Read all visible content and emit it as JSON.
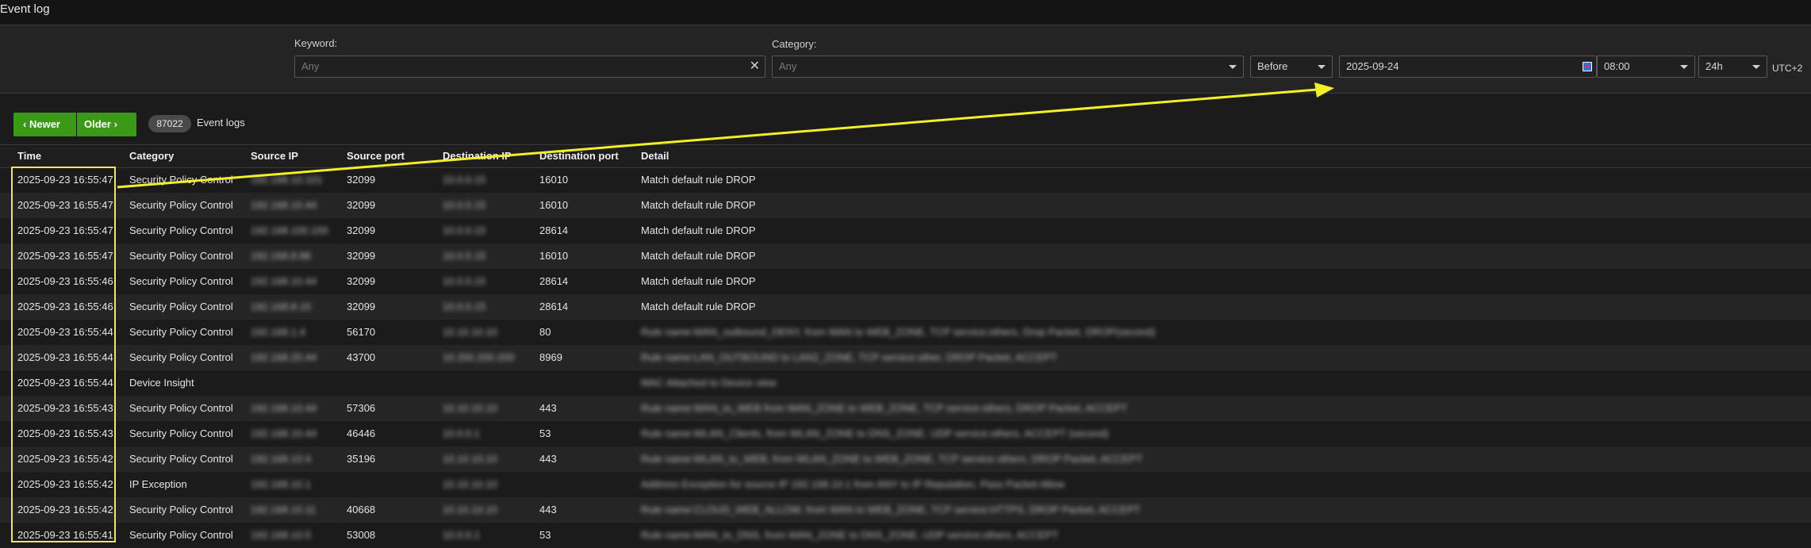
{
  "page_title": "Event log",
  "filters": {
    "keyword_label": "Keyword:",
    "keyword_placeholder": "Any",
    "category_label": "Category:",
    "category_placeholder": "Any",
    "time_relation": "Before",
    "date": "2025-09-24",
    "time": "08:00",
    "time_format": "24h",
    "timezone": "UTC+2"
  },
  "nav": {
    "newer_label": "Newer",
    "older_label": "Older"
  },
  "log_count": "87022",
  "log_count_label": "Event logs",
  "columns": [
    "Time",
    "Category",
    "Source IP",
    "Source port",
    "Destination IP",
    "Destination port",
    "Detail"
  ],
  "rows": [
    {
      "time": "2025-09-23 16:55:47",
      "category": "Security Policy Control",
      "src_ip": "192.168.10.101",
      "src_port": "32099",
      "dst_ip": "10.0.0.15",
      "dst_port": "16010",
      "detail": "Match default rule DROP"
    },
    {
      "time": "2025-09-23 16:55:47",
      "category": "Security Policy Control",
      "src_ip": "192.168.10.44",
      "src_port": "32099",
      "dst_ip": "10.0.0.15",
      "dst_port": "16010",
      "detail": "Match default rule DROP"
    },
    {
      "time": "2025-09-23 16:55:47",
      "category": "Security Policy Control",
      "src_ip": "192.168.100.100",
      "src_port": "32099",
      "dst_ip": "10.0.0.15",
      "dst_port": "28614",
      "detail": "Match default rule DROP"
    },
    {
      "time": "2025-09-23 16:55:47",
      "category": "Security Policy Control",
      "src_ip": "192.168.8.88",
      "src_port": "32099",
      "dst_ip": "10.0.0.15",
      "dst_port": "16010",
      "detail": "Match default rule DROP"
    },
    {
      "time": "2025-09-23 16:55:46",
      "category": "Security Policy Control",
      "src_ip": "192.168.10.44",
      "src_port": "32099",
      "dst_ip": "10.0.0.15",
      "dst_port": "28614",
      "detail": "Match default rule DROP"
    },
    {
      "time": "2025-09-23 16:55:46",
      "category": "Security Policy Control",
      "src_ip": "192.168.8.10",
      "src_port": "32099",
      "dst_ip": "10.0.0.15",
      "dst_port": "28614",
      "detail": "Match default rule DROP"
    },
    {
      "time": "2025-09-23 16:55:44",
      "category": "Security Policy Control",
      "src_ip": "192.168.1.4",
      "src_port": "56170",
      "dst_ip": "10.10.10.10",
      "dst_port": "80",
      "detail": "Rule name:WAN_outbound_DENY, from WAN to WEB_ZONE, TCP service:others, Drop Packet, DROP(second)"
    },
    {
      "time": "2025-09-23 16:55:44",
      "category": "Security Policy Control",
      "src_ip": "192.168.20.44",
      "src_port": "43700",
      "dst_ip": "10.200.200.200",
      "dst_port": "8969",
      "detail": "Rule name:LAN_OUTBOUND to LAN2_ZONE, TCP service:other, DROP Packet, ACCEPT"
    },
    {
      "time": "2025-09-23 16:55:44",
      "category": "Device Insight",
      "src_ip": "",
      "src_port": "",
      "dst_ip": "",
      "dst_port": "",
      "detail": "MAC Attached to Device view"
    },
    {
      "time": "2025-09-23 16:55:43",
      "category": "Security Policy Control",
      "src_ip": "192.168.10.44",
      "src_port": "57306",
      "dst_ip": "10.10.10.10",
      "dst_port": "443",
      "detail": "Rule name:WAN_to_WEB from WAN_ZONE to WEB_ZONE, TCP service:others, DROP Packet, ACCEPT"
    },
    {
      "time": "2025-09-23 16:55:43",
      "category": "Security Policy Control",
      "src_ip": "192.168.10.44",
      "src_port": "46446",
      "dst_ip": "10.0.0.1",
      "dst_port": "53",
      "detail": "Rule name:WLAN_Clients, from WLAN_ZONE to DNS_ZONE, UDP service:others, ACCEPT (second)"
    },
    {
      "time": "2025-09-23 16:55:42",
      "category": "Security Policy Control",
      "src_ip": "192.168.10.4",
      "src_port": "35196",
      "dst_ip": "10.10.10.10",
      "dst_port": "443",
      "detail": "Rule name:WLAN_to_WEB, from WLAN_ZONE to WEB_ZONE, TCP service others, DROP Packet, ACCEPT"
    },
    {
      "time": "2025-09-23 16:55:42",
      "category": "IP Exception",
      "src_ip": "192.168.10.1",
      "src_port": "",
      "dst_ip": "10.10.10.10",
      "dst_port": "",
      "detail": "Address Exception for source IP 192.168.10.1 from ANY to IP Reputation, Pass Packet Allow"
    },
    {
      "time": "2025-09-23 16:55:42",
      "category": "Security Policy Control",
      "src_ip": "192.168.10.11",
      "src_port": "40668",
      "dst_ip": "10.10.10.10",
      "dst_port": "443",
      "detail": "Rule name:CLOUD_WEB_ALLOW, from WAN to WEB_ZONE, TCP service:HTTPS, DROP Packet, ACCEPT"
    },
    {
      "time": "2025-09-23 16:55:41",
      "category": "Security Policy Control",
      "src_ip": "192.168.10.5",
      "src_port": "53008",
      "dst_ip": "10.0.0.1",
      "dst_port": "53",
      "detail": "Rule name:WAN_to_DNS, from WAN_ZONE to DNS_ZONE, UDP service:others, ACCEPT"
    }
  ],
  "colors": {
    "accent_green": "#3a9a16",
    "annotation_yellow": "#e8e86a"
  }
}
